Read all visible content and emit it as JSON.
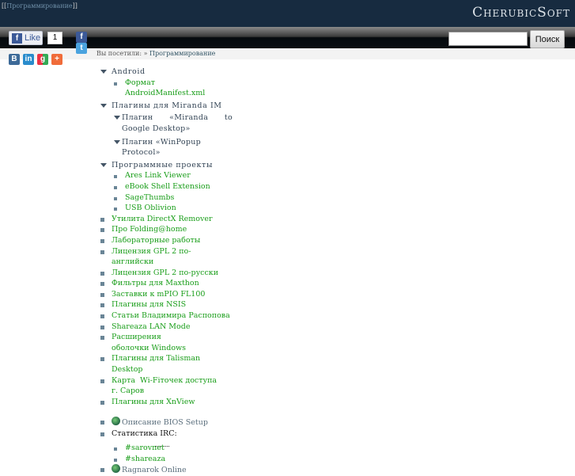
{
  "header": {
    "crumb_open": "[[",
    "crumb_link": "Программирование",
    "crumb_close": "]]",
    "logo": "CherubicSoft"
  },
  "social": {
    "like_label": "Like",
    "like_count": "1",
    "icons": [
      "facebook-icon",
      "twitter-icon",
      "vkontakte-icon",
      "linkedin-icon",
      "google-plus-icon",
      "addthis-icon"
    ]
  },
  "search": {
    "value": "",
    "button": "Поиск"
  },
  "visited": {
    "label": "Вы посетили: »",
    "link": "Программирование"
  },
  "tree": {
    "android": {
      "label": "Android",
      "items": [
        "Формат AndroidManifest.xml"
      ]
    },
    "miranda": {
      "label": "Плагины для Miranda IM",
      "items": [
        "Плагин «Miranda to Google Desktop»",
        "Плагин «WinPopup Protocol»"
      ]
    },
    "projects": {
      "label": "Программные проекты",
      "items": [
        "Ares Link Viewer",
        "eBook Shell Extension",
        "SageThumbs",
        "USB Oblivion"
      ]
    },
    "links": [
      "Утилита DirectX Remover",
      "Про Folding@home",
      "Лабораторные работы",
      "Лицензия GPL 2 по-английски",
      "Лицензия GPL 2 по-русски",
      "Фильтры для Maxthon",
      "Заставки к mPIO FL100",
      "Плагины для NSIS",
      "Статьи Владимира Распопова",
      "Shareaza LAN Mode",
      "Расширения оболочки Windows",
      "Плагины для Talisman Desktop",
      "Карта  Wi-Fiточек доступа г. Саров",
      "Плагины для XnView"
    ],
    "bios": "Описание BIOS Setup",
    "irc": {
      "label": "Статистика IRC:",
      "items": [
        "#sarovnet",
        "#shareaza"
      ]
    },
    "ragnarok": "Ragnarok Online"
  }
}
